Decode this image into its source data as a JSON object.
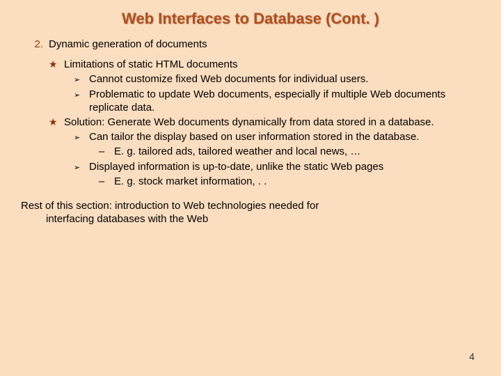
{
  "title": "Web Interfaces to Database (Cont. )",
  "list": {
    "number": "2.",
    "heading": "Dynamic generation of documents",
    "stars": [
      {
        "text": "Limitations of static HTML documents",
        "arrows": [
          {
            "text": "Cannot customize fixed Web documents for individual users.",
            "dashes": []
          },
          {
            "text": "Problematic to update Web documents, especially if multiple Web documents replicate data.",
            "dashes": []
          }
        ]
      },
      {
        "text": "Solution: Generate Web documents dynamically from data stored in a database.",
        "arrows": [
          {
            "text": "Can tailor the display based on user information stored in the database.",
            "dashes": [
              {
                "text": "E. g. tailored ads, tailored weather and local news, …"
              }
            ]
          },
          {
            "text": "Displayed information is up-to-date, unlike the static Web pages",
            "dashes": [
              {
                "text": "E. g. stock market information, . ."
              }
            ]
          }
        ]
      }
    ]
  },
  "closing_line1": "Rest of this section: introduction to Web technologies needed for",
  "closing_line2": "interfacing databases with the Web",
  "page_number": "4",
  "markers": {
    "star": "★",
    "arrow": "➢",
    "dash": "–"
  }
}
